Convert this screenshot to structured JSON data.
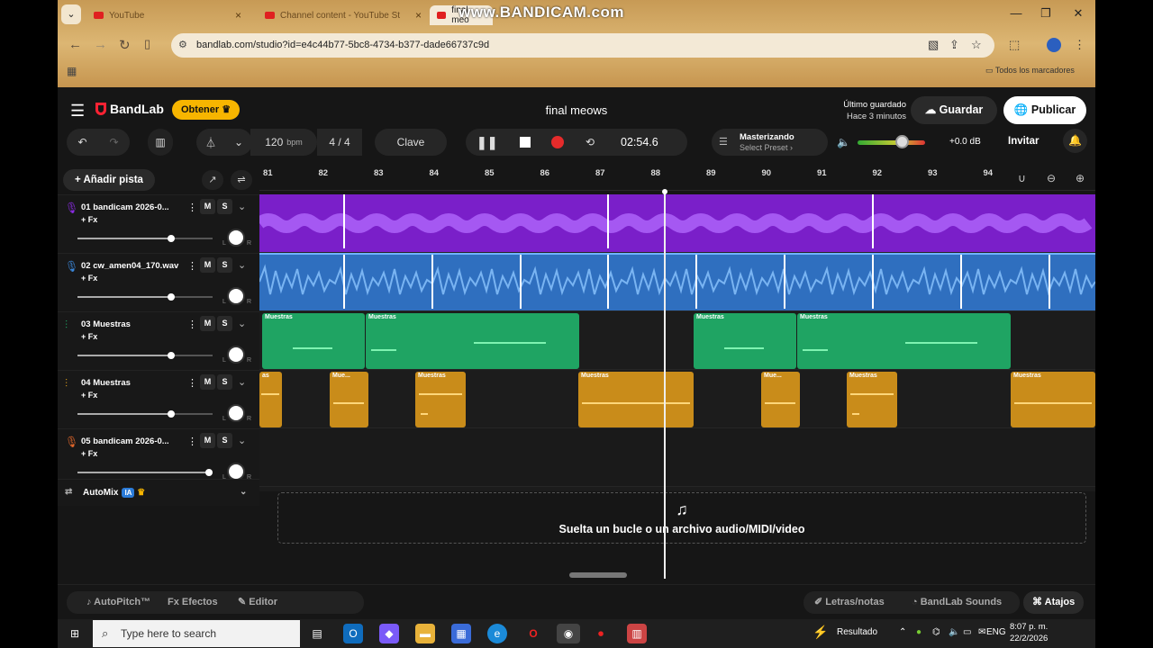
{
  "browser": {
    "tabs": [
      {
        "label": "YouTube"
      },
      {
        "label": "Channel content - YouTube St"
      },
      {
        "label": "final meo"
      }
    ],
    "watermark": "www.BANDICAM.com",
    "url": "bandlab.com/studio?id=e4c44b77-5bc8-4734-b377-dade66737c9d",
    "bookmarks_label": "Todos los marcadores"
  },
  "app": {
    "brand": "BandLab",
    "get_button": "Obtener",
    "project_title": "final meows",
    "saved_label": "Último guardado",
    "saved_time": "Hace 3 minutos",
    "save_button": "Guardar",
    "publish_button": "Publicar",
    "invite_button": "Invitar"
  },
  "transport": {
    "bpm": "120",
    "bpm_unit": "bpm",
    "time_sig": "4 / 4",
    "key_label": "Clave",
    "time": "02:54.6",
    "mastering_title": "Masterizando",
    "mastering_preset": "Select Preset ›",
    "volume_db": "+0.0 dB",
    "volume_level": 0.67
  },
  "sidebar": {
    "add_track": "Añadir pista",
    "automix_label": "AutoMix",
    "automix_badge": "IA"
  },
  "tracks": [
    {
      "name": "01  bandicam 2026-0...",
      "fx": "+ Fx",
      "m": "M",
      "s": "S",
      "color": "#8a2be2",
      "volume": 0.69,
      "lr_l": "L",
      "lr_r": "R"
    },
    {
      "name": "02  cw_amen04_170.wav",
      "fx": "+ Fx",
      "m": "M",
      "s": "S",
      "color": "#3a86d9",
      "volume": 0.69,
      "lr_l": "L",
      "lr_r": "R"
    },
    {
      "name": "03  Muestras",
      "fx": "+ Fx",
      "m": "M",
      "s": "S",
      "color": "#1fa463",
      "volume": 0.69,
      "lr_l": "L",
      "lr_r": "R"
    },
    {
      "name": "04  Muestras",
      "fx": "+ Fx",
      "m": "M",
      "s": "S",
      "color": "#d89a1c",
      "volume": 0.69,
      "lr_l": "L",
      "lr_r": "R"
    },
    {
      "name": "05  bandicam 2026-0...",
      "fx": "+ Fx",
      "m": "M",
      "s": "S",
      "color": "#e0662a",
      "volume": 0.97,
      "lr_l": "L",
      "lr_r": "R"
    }
  ],
  "ruler": [
    "81",
    "82",
    "83",
    "84",
    "85",
    "86",
    "87",
    "88",
    "89",
    "90",
    "91",
    "92",
    "93",
    "94"
  ],
  "clip_label": "Muestras",
  "clip_label_short": "Mue...",
  "clip_label_tail": "as",
  "drop_zone": "Suelta un bucle o un archivo audio/MIDI/video",
  "bottom_bar": {
    "autopitch": "AutoPitch™",
    "effects": "Efectos",
    "editor": "Editor",
    "lyrics": "Letras/notas",
    "sounds": "BandLab Sounds",
    "shortcuts": "Atajos"
  },
  "taskbar": {
    "search_placeholder": "Type here to search",
    "weather": "Resultado",
    "lang": "ENG",
    "time": "8:07 p. m.",
    "date": "22/2/2026"
  }
}
